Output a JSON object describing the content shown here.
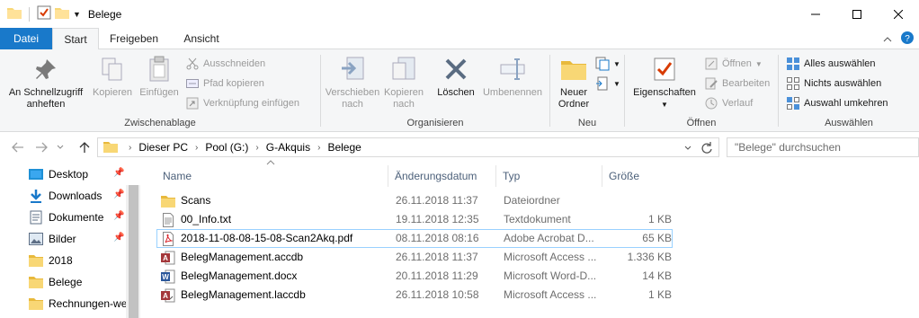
{
  "window": {
    "title": "Belege"
  },
  "tabs": {
    "file": "Datei",
    "start": "Start",
    "share": "Freigeben",
    "view": "Ansicht"
  },
  "ribbon": {
    "clipboard": {
      "label": "Zwischenablage",
      "pin": "An Schnellzugriff anheften",
      "copy": "Kopieren",
      "paste": "Einfügen",
      "cut": "Ausschneiden",
      "copy_path": "Pfad kopieren",
      "paste_shortcut": "Verknüpfung einfügen"
    },
    "organize": {
      "label": "Organisieren",
      "move_to": "Verschieben nach",
      "copy_to": "Kopieren nach",
      "delete": "Löschen",
      "rename": "Umbenennen"
    },
    "new": {
      "label": "Neu",
      "new_folder": "Neuer Ordner"
    },
    "open": {
      "label": "Öffnen",
      "properties": "Eigenschaften",
      "open": "Öffnen",
      "edit": "Bearbeiten",
      "history": "Verlauf"
    },
    "select": {
      "label": "Auswählen",
      "select_all": "Alles auswählen",
      "select_none": "Nichts auswählen",
      "invert": "Auswahl umkehren"
    }
  },
  "address": {
    "crumbs": [
      "Dieser PC",
      "Pool (G:)",
      "G-Akquis",
      "Belege"
    ],
    "search_placeholder": "\"Belege\" durchsuchen"
  },
  "nav": {
    "items": [
      {
        "label": "Desktop",
        "icon": "desktop-icon",
        "pinned": true
      },
      {
        "label": "Downloads",
        "icon": "download-icon",
        "pinned": true
      },
      {
        "label": "Dokumente",
        "icon": "document-icon",
        "pinned": true
      },
      {
        "label": "Bilder",
        "icon": "pictures-icon",
        "pinned": true
      },
      {
        "label": "2018",
        "icon": "folder-icon",
        "pinned": false
      },
      {
        "label": "Belege",
        "icon": "folder-icon",
        "pinned": false
      },
      {
        "label": "Rechnungen-we",
        "icon": "folder-icon",
        "pinned": false
      }
    ],
    "pin_glyph": "📌"
  },
  "files": {
    "columns": {
      "name": "Name",
      "date": "Änderungsdatum",
      "type": "Typ",
      "size": "Größe"
    },
    "rows": [
      {
        "name": "Scans",
        "date": "26.11.2018 11:37",
        "type": "Dateiordner",
        "size": "",
        "icon": "folder-icon"
      },
      {
        "name": "00_Info.txt",
        "date": "19.11.2018 12:35",
        "type": "Textdokument",
        "size": "1 KB",
        "icon": "text-file-icon"
      },
      {
        "name": "2018-11-08-08-15-08-Scan2Akq.pdf",
        "date": "08.11.2018 08:16",
        "type": "Adobe Acrobat D...",
        "size": "65 KB",
        "icon": "pdf-icon",
        "selected": true
      },
      {
        "name": "BelegManagement.accdb",
        "date": "26.11.2018 11:37",
        "type": "Microsoft Access ...",
        "size": "1.336 KB",
        "icon": "access-icon"
      },
      {
        "name": "BelegManagement.docx",
        "date": "20.11.2018 11:29",
        "type": "Microsoft Word-D...",
        "size": "14 KB",
        "icon": "word-icon"
      },
      {
        "name": "BelegManagement.laccdb",
        "date": "26.11.2018 10:58",
        "type": "Microsoft Access ...",
        "size": "1 KB",
        "icon": "access-icon"
      }
    ]
  }
}
